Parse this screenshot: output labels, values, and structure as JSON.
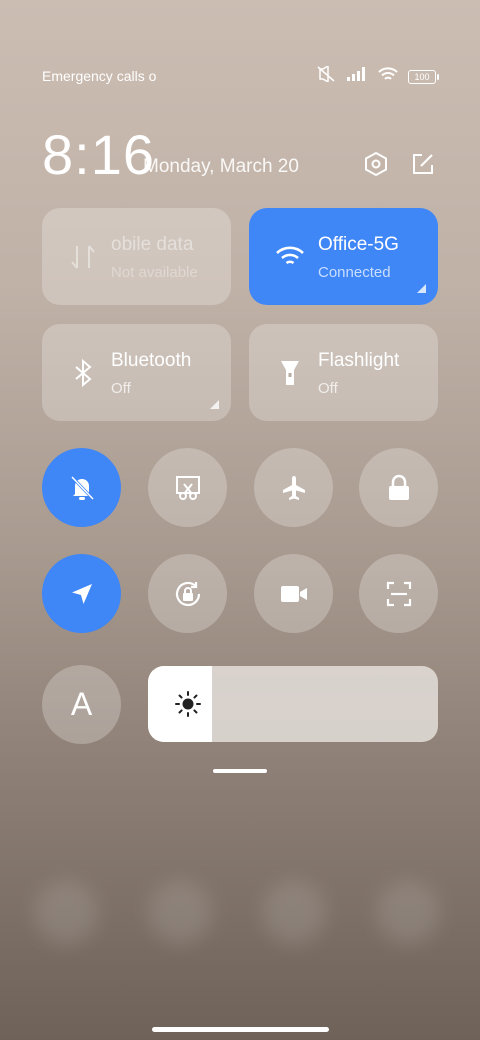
{
  "status_bar": {
    "carrier_text": "Emergency calls o",
    "battery_level": "100",
    "icons": [
      "mute-icon",
      "signal-icon",
      "wifi-icon",
      "battery-icon"
    ]
  },
  "header": {
    "time": "8:16",
    "date": "Monday, March 20",
    "icons": [
      "settings-icon",
      "edit-icon"
    ]
  },
  "tiles": [
    {
      "label": "obile data",
      "status": "Not available",
      "icon": "mobile-data-icon",
      "active": false
    },
    {
      "label": "Office-5G",
      "status": "Connected",
      "icon": "wifi-icon",
      "active": true
    },
    {
      "label": "Bluetooth",
      "status": "Off",
      "icon": "bluetooth-icon",
      "active": false
    },
    {
      "label": "Flashlight",
      "status": "Off",
      "icon": "flashlight-icon",
      "active": false
    }
  ],
  "toggles": [
    {
      "name": "silent",
      "icon": "bell-off-icon",
      "active": true
    },
    {
      "name": "screenshot",
      "icon": "scissors-icon",
      "active": false
    },
    {
      "name": "airplane-mode",
      "icon": "airplane-icon",
      "active": false
    },
    {
      "name": "lock-screen",
      "icon": "lock-icon",
      "active": false
    },
    {
      "name": "location",
      "icon": "location-arrow-icon",
      "active": true
    },
    {
      "name": "rotation-lock",
      "icon": "rotation-lock-icon",
      "active": false
    },
    {
      "name": "screen-recorder",
      "icon": "video-camera-icon",
      "active": false
    },
    {
      "name": "scanner",
      "icon": "scan-icon",
      "active": false
    }
  ],
  "auto_brightness": {
    "label": "A"
  },
  "brightness": {
    "level_fraction": 0.22,
    "icon": "sun-icon"
  },
  "colors": {
    "accent": "#3f86f7",
    "tile_bg": "rgba(255,255,255,0.25)"
  }
}
